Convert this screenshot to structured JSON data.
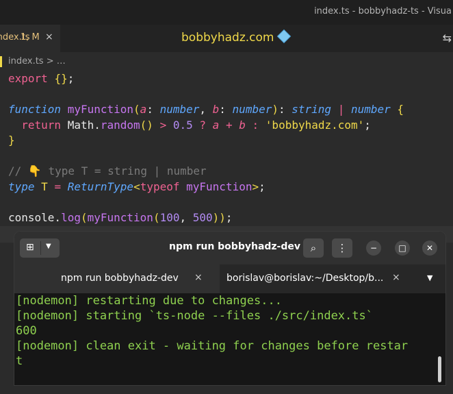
{
  "editor": {
    "window_title": "index.ts - bobbyhadz-ts - Visua",
    "tab": {
      "file": "index.ts",
      "status": "1, M",
      "close": "×"
    },
    "brand": "bobbyhadz.com",
    "split_icon": "⇆",
    "breadcrumb": "index.ts  >  …",
    "code_lines": [
      {
        "segments": [
          [
            "kw",
            "export"
          ],
          [
            "plain",
            " "
          ],
          [
            "punc",
            "{}"
          ],
          [
            "plain",
            ";"
          ]
        ]
      },
      {
        "segments": []
      },
      {
        "segments": [
          [
            "kw-it",
            "function"
          ],
          [
            "plain",
            " "
          ],
          [
            "fn",
            "myFunction"
          ],
          [
            "punc",
            "("
          ],
          [
            "param",
            "a"
          ],
          [
            "plain",
            ": "
          ],
          [
            "type",
            "number"
          ],
          [
            "plain",
            ", "
          ],
          [
            "param",
            "b"
          ],
          [
            "plain",
            ": "
          ],
          [
            "type",
            "number"
          ],
          [
            "punc",
            ")"
          ],
          [
            "plain",
            ": "
          ],
          [
            "type",
            "string"
          ],
          [
            "plain",
            " "
          ],
          [
            "op",
            "|"
          ],
          [
            "plain",
            " "
          ],
          [
            "type",
            "number"
          ],
          [
            "plain",
            " "
          ],
          [
            "punc",
            "{"
          ]
        ]
      },
      {
        "segments": [
          [
            "plain",
            "  "
          ],
          [
            "kw",
            "return"
          ],
          [
            "plain",
            " Math."
          ],
          [
            "method",
            "random"
          ],
          [
            "punc",
            "()"
          ],
          [
            "plain",
            " "
          ],
          [
            "op",
            ">"
          ],
          [
            "plain",
            " "
          ],
          [
            "num",
            "0.5"
          ],
          [
            "plain",
            " "
          ],
          [
            "op",
            "?"
          ],
          [
            "plain",
            " "
          ],
          [
            "param",
            "a"
          ],
          [
            "plain",
            " "
          ],
          [
            "op",
            "+"
          ],
          [
            "plain",
            " "
          ],
          [
            "param",
            "b"
          ],
          [
            "plain",
            " "
          ],
          [
            "op",
            ":"
          ],
          [
            "plain",
            " "
          ],
          [
            "str",
            "'bobbyhadz.com'"
          ],
          [
            "plain",
            ";"
          ]
        ]
      },
      {
        "segments": [
          [
            "punc",
            "}"
          ]
        ]
      },
      {
        "segments": []
      },
      {
        "segments": [
          [
            "comment",
            "// 👇 type T = string | number"
          ]
        ]
      },
      {
        "segments": [
          [
            "kw-it",
            "type"
          ],
          [
            "plain",
            " "
          ],
          [
            "str",
            "T"
          ],
          [
            "plain",
            " "
          ],
          [
            "op",
            "="
          ],
          [
            "plain",
            " "
          ],
          [
            "type",
            "ReturnType"
          ],
          [
            "punc",
            "<"
          ],
          [
            "kw",
            "typeof"
          ],
          [
            "plain",
            " "
          ],
          [
            "fn",
            "myFunction"
          ],
          [
            "punc",
            ">"
          ],
          [
            "plain",
            ";"
          ]
        ]
      },
      {
        "segments": []
      },
      {
        "segments": [
          [
            "plain",
            "console."
          ],
          [
            "method",
            "log"
          ],
          [
            "punc",
            "("
          ],
          [
            "fn",
            "myFunction"
          ],
          [
            "punc",
            "("
          ],
          [
            "num",
            "100"
          ],
          [
            "plain",
            ", "
          ],
          [
            "num",
            "500"
          ],
          [
            "punc",
            "))"
          ],
          [
            "plain",
            ";"
          ]
        ]
      }
    ]
  },
  "terminal": {
    "title": "npm run bobbyhadz-dev",
    "new_tab_icon": "new-tab-icon",
    "tabs": [
      {
        "label": "npm run bobbyhadz-dev",
        "close": "×"
      },
      {
        "label": "borislav@borislav:~/Desktop/b...",
        "close": "×"
      }
    ],
    "tabs_menu": "▼",
    "output": [
      "[nodemon] restarting due to changes...",
      "[nodemon] starting `ts-node --files ./src/index.ts`",
      "600",
      "[nodemon] clean exit - waiting for changes before restar",
      "t"
    ],
    "buttons": {
      "search": "🔍",
      "menu": "⋮",
      "minimize": "−",
      "maximize": "□",
      "close": "✕"
    },
    "colors": {
      "output": "#8fd14f",
      "background": "#161616"
    }
  }
}
